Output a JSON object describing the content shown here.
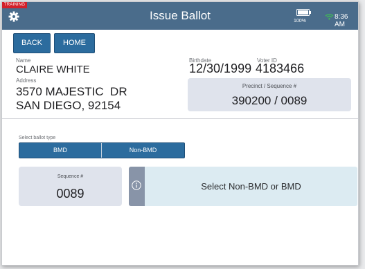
{
  "header": {
    "training_badge": "TRAINING",
    "title": "Issue Ballot",
    "battery": "100%",
    "time": "8:36 AM",
    "icons": [
      "gear-icon",
      "battery-icon",
      "wifi-icon"
    ]
  },
  "nav": {
    "back_label": "BACK",
    "home_label": "HOME"
  },
  "voter": {
    "name_label": "Name",
    "name": "CLAIRE WHITE",
    "address_label": "Address",
    "address_line1": "3570 MAJESTIC  DR",
    "address_line2": "SAN DIEGO, 92154",
    "birthdate_label": "Birthdate",
    "birthdate": "12/30/1999",
    "voter_id_label": "Voter ID",
    "voter_id": "4183466",
    "precinct_label": "Precinct / Sequence #",
    "precinct_value": "390200 / 0089"
  },
  "ballot": {
    "select_label": "Select ballot type",
    "options": [
      "BMD",
      "Non-BMD"
    ],
    "sequence_label": "Sequence #",
    "sequence_value": "0089",
    "message": "Select Non-BMD or BMD"
  },
  "colors": {
    "header": "#4a6c8b",
    "button": "#2c6c9e",
    "training": "#d3202a",
    "panel": "#dfe3ec",
    "message_panel": "#dcebf2",
    "info_bar": "#8894a8",
    "wifi": "#3fbf52"
  }
}
